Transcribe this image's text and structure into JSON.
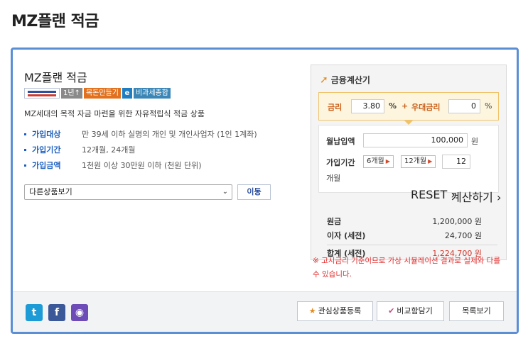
{
  "page_title": "MZ플랜 적금",
  "product": {
    "name": "MZ플랜 적금",
    "badges": {
      "duration": "1년↑",
      "sfc": "목돈만들기",
      "e": "e",
      "tax": "비과세종합"
    },
    "description": "MZ세대의 목적 자금 마련을 위한 자유적립식 적금 상품",
    "info": [
      {
        "label": "가입대상",
        "value": "만 39세 이하 실명의 개인 및 개인사업자 (1인 1계좌)"
      },
      {
        "label": "가입기간",
        "value": "12개월, 24개월"
      },
      {
        "label": "가입금액",
        "value": "1천원 이상 30만원 이하 (천원 단위)"
      }
    ],
    "select_value": "다른상품보기",
    "move_button": "이동"
  },
  "calculator": {
    "title": "금융계산기",
    "rate_label": "금리",
    "rate_value": "3.80",
    "rate_unit": "%",
    "plus": "+",
    "bonus_label": "우대금리",
    "bonus_value": "0",
    "bonus_unit": "%",
    "monthly_label": "월납입액",
    "monthly_value": "100,000",
    "won": "원",
    "period_label": "가입기간",
    "period_opt1": "6개월",
    "period_opt2": "12개월",
    "period_value": "12",
    "period_unit": "개월",
    "reset": "RESET",
    "compute": "계산하기",
    "results": [
      {
        "label": "원금",
        "value": "1,200,000 원"
      },
      {
        "label": "이자 (세전)",
        "value": "24,700 원"
      },
      {
        "label": "합계 (세전)",
        "value": "1,224,700 원"
      }
    ],
    "note": "※ 고시금리 기준이므로 가상 시뮬레이션 결과로 실제와 다를 수 있습니다."
  },
  "footer": {
    "twitter": "t",
    "facebook": "f",
    "kakao": "◉",
    "wish": "관심상품등록",
    "compare": "비교함담기",
    "list": "목록보기"
  }
}
